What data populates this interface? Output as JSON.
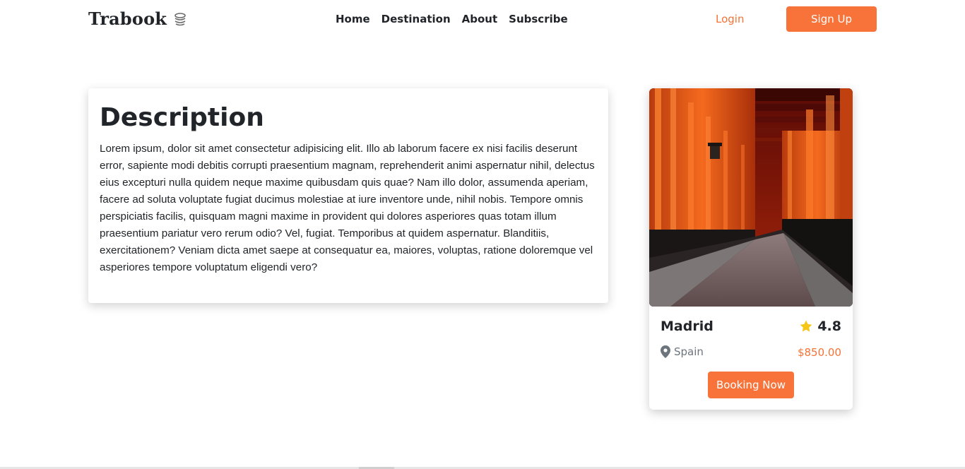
{
  "nav": {
    "brand": "Trabook",
    "brand_icon": "stacked-coins-icon",
    "menu": [
      "Home",
      "Destination",
      "About",
      "Subscribe"
    ],
    "login_label": "Login",
    "signup_label": "Sign Up"
  },
  "description": {
    "title": "Description",
    "body": "Lorem ipsum, dolor sit amet consectetur adipisicing elit. Illo ab laborum facere ex nisi facilis deserunt error, sapiente modi debitis corrupti praesentium magnam, reprehenderit animi aspernatur nihil, delectus eius excepturi nulla quidem neque maxime quibusdam quis quae? Nam illo dolor, assumenda aperiam, facere ad soluta voluptate fugiat ducimus molestiae at iure inventore unde, nihil nobis. Tempore omnis perspiciatis facilis, quisquam magni maxime in provident qui dolores asperiores quas totam illum praesentium pariatur vero rerum odio? Vel, fugiat. Temporibus at quidem aspernatur. Blanditiis, exercitationem? Veniam dicta amet saepe at consequatur ea, maiores, voluptas, ratione doloremque vel asperiores tempore voluptatum eligendi vero?"
  },
  "card": {
    "image": "torii-gates-tunnel-photo",
    "city": "Madrid",
    "rating": "4.8",
    "rating_icon": "star-icon",
    "location": "Spain",
    "location_icon": "map-pin-icon",
    "price": "$850.00",
    "book_label": "Booking Now"
  },
  "colors": {
    "accent": "#f8733a",
    "accent_text": "#f57336",
    "star": "#f5c518",
    "muted": "#6c757d",
    "text": "#212529"
  }
}
